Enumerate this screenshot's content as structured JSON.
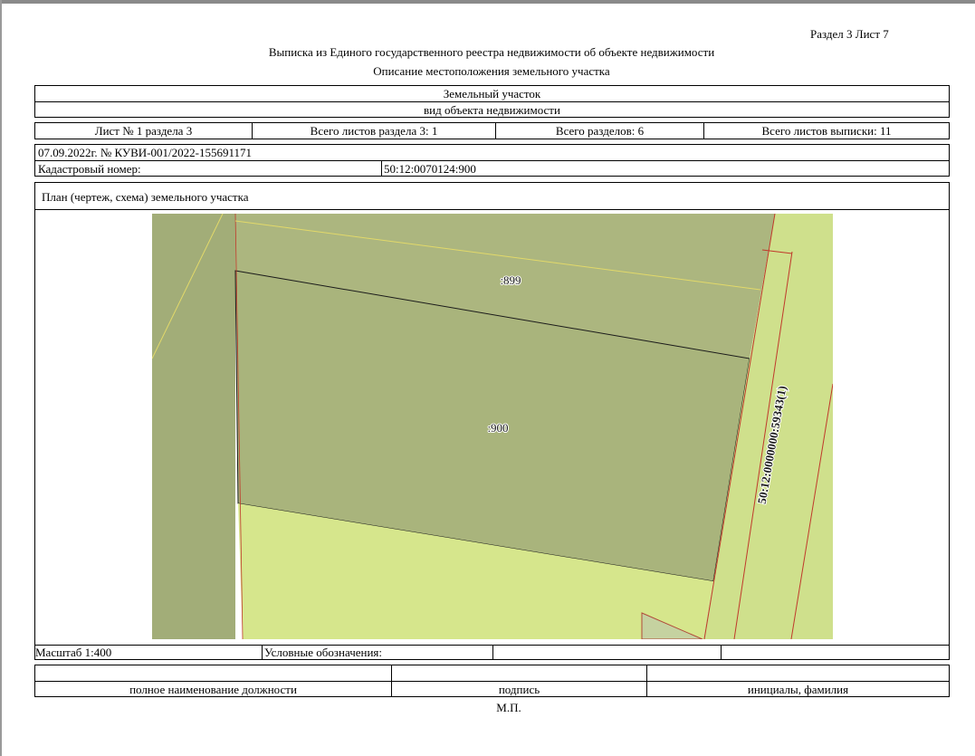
{
  "header": {
    "section_sheet": "Раздел 3    Лист 7",
    "title": "Выписка из Единого государственного реестра недвижимости об объекте недвижимости",
    "subtitle": "Описание местоположения земельного участка"
  },
  "object": {
    "type": "Земельный участок",
    "type_caption": "вид объекта недвижимости"
  },
  "sheets": {
    "sheet": "Лист № 1 раздела 3",
    "total_sheets_section": "Всего листов раздела 3: 1",
    "total_sections": "Всего разделов: 6",
    "total_sheets_extract": "Всего листов выписки: 11"
  },
  "doc": {
    "date_number": "07.09.2022г. № КУВИ-001/2022-155691171",
    "cadastral_label": "Кадастровый номер:",
    "cadastral_value": "50:12:0070124:900"
  },
  "plan": {
    "title": "План (чертеж, схема) земельного участка",
    "label_899": ":899",
    "label_900": ":900",
    "label_road": "50:12:0000000:59343(1)"
  },
  "footer": {
    "scale": "Масштаб 1:400",
    "legend": "Условные обозначения:",
    "position_caption": "полное наименование должности",
    "signature_caption": "подпись",
    "initials_caption": "инициалы, фамилия",
    "stamp": "М.П."
  },
  "colors": {
    "parcel_dark": "#a9b47c",
    "parcel_899": "#acb67f",
    "side_strip": "#a2ad78",
    "light_green": "#d6e68c",
    "road_strip": "#cfe08c",
    "boundary_red": "#c0392b",
    "boundary_yellow": "#e2d96a"
  }
}
